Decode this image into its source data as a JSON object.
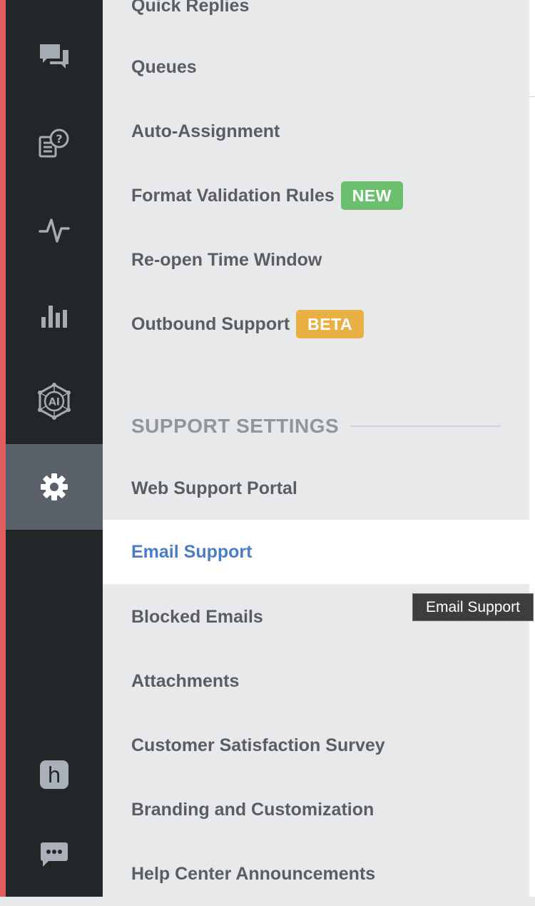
{
  "sidebar": {
    "items": [
      {
        "icon": "chat-bubbles-icon",
        "active": false
      },
      {
        "icon": "knowledge-base-icon",
        "active": false
      },
      {
        "icon": "activity-pulse-icon",
        "active": false
      },
      {
        "icon": "bar-chart-icon",
        "active": false
      },
      {
        "icon": "ai-icon",
        "label": "AI",
        "active": false
      },
      {
        "icon": "gear-icon",
        "active": true
      }
    ],
    "bottom": [
      {
        "icon": "h-logo-icon",
        "label": "h"
      },
      {
        "icon": "message-dots-icon"
      }
    ]
  },
  "menu": {
    "items": [
      {
        "label": "Quick Replies"
      },
      {
        "label": "Queues"
      },
      {
        "label": "Auto-Assignment"
      },
      {
        "label": "Format Validation Rules",
        "badge": "NEW"
      },
      {
        "label": "Re-open Time Window"
      },
      {
        "label": "Outbound Support",
        "badge": "BETA"
      }
    ],
    "section_title": "SUPPORT SETTINGS",
    "support_items": [
      {
        "label": "Web Support Portal"
      },
      {
        "label": "Email Support",
        "active": true
      },
      {
        "label": "Blocked Emails"
      },
      {
        "label": "Attachments"
      },
      {
        "label": "Customer Satisfaction Survey"
      },
      {
        "label": "Branding and Customization"
      },
      {
        "label": "Help Center Announcements"
      }
    ]
  },
  "tooltip": {
    "text": "Email Support"
  },
  "colors": {
    "accent_strip": "#e05d5d",
    "sidebar_bg": "#222629",
    "active_rail": "#5b6168",
    "menu_text": "#5a5e63",
    "active_text": "#4a7ec2",
    "badge_new": "#6bbf6e",
    "badge_beta": "#e9b043"
  }
}
